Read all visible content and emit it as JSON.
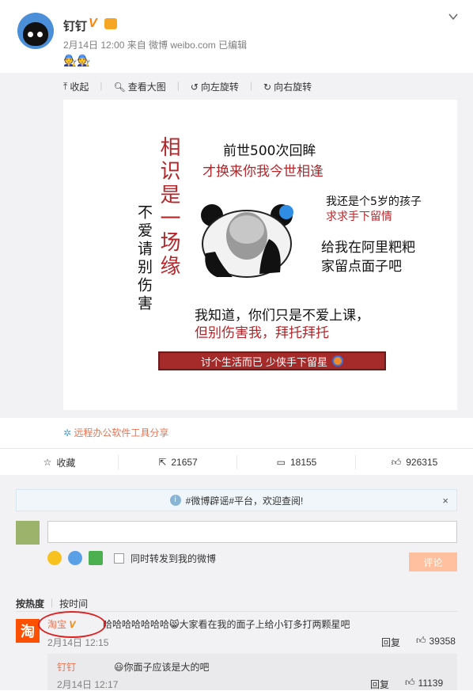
{
  "post": {
    "username": "钉钉",
    "verified_mark": "V",
    "meta": "2月14日 12:00 来自 微博 weibo.com   已编辑",
    "emoji": "🧑‍🔧🧑‍🔧"
  },
  "image_tools": {
    "collapse": "收起",
    "view_large": "查看大图",
    "rotate_left": "向左旋转",
    "rotate_right": "向右旋转"
  },
  "meme": {
    "vertical_red": "相识是一场缘",
    "vertical_black": "不爱请别伤害",
    "line1": "前世500次回眸",
    "line2": "才换来你我今世相逢",
    "line3": "我还是个5岁的孩子",
    "line4": "求求手下留情",
    "line5": "给我在阿里粑粑",
    "line6": "家留点面子吧",
    "line7": "我知道，你们只是不爱上课，",
    "line8": "但别伤害我，拜托拜托",
    "banner": "讨个生活而已 少侠手下留星"
  },
  "link": {
    "text": "远程办公软件工具分享"
  },
  "actions": {
    "collect": "收藏",
    "repost": "21657",
    "comment": "18155",
    "like": "926315"
  },
  "notice": {
    "text": "#微博辟谣#平台，欢迎查阅!",
    "close": "×"
  },
  "composer": {
    "sync_label": "同时转发到我的微博",
    "submit": "评论"
  },
  "sort": {
    "hot": "按热度",
    "time": "按时间"
  },
  "comments": [
    {
      "name": "淘宝",
      "text": "哈哈哈哈哈哈哈😸大家看在我的面子上给小钉多打两颗星吧",
      "time": "2月14日 12:15",
      "reply": "回复",
      "likes": "39358",
      "avatar_text": "淘"
    }
  ],
  "sub_comment": {
    "name": "钉钉",
    "text": "😃你面子应该是大的吧",
    "time": "2月14日 12:17",
    "reply": "回复",
    "likes": "11139"
  },
  "colors": {
    "accent": "#eb7350",
    "orange": "#ff8200",
    "meme_red": "#b5262a"
  }
}
